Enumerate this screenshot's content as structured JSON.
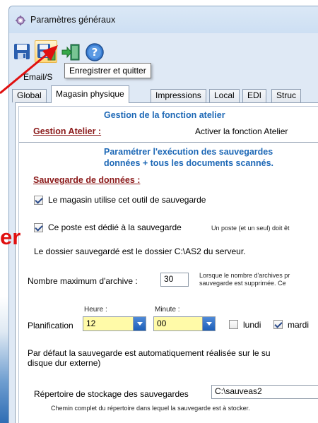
{
  "window": {
    "title": "Paramètres généraux"
  },
  "toolbar": {
    "buttons": [
      {
        "name": "save-icon"
      },
      {
        "name": "save-and-quit-icon"
      },
      {
        "name": "exit-icon"
      },
      {
        "name": "help-icon"
      }
    ],
    "tooltip": "Enregistrer et quitter",
    "hidden_label": "Email/S"
  },
  "tabs": [
    "Global",
    "Magasin physique",
    "Impressions",
    "Local",
    "EDI",
    "Struc"
  ],
  "active_tab": "Magasin physique",
  "atelier": {
    "header": "Gestion de la fonction atelier",
    "label": "Gestion Atelier :",
    "option": "Activer la fonction Atelier"
  },
  "backup": {
    "header_line1": "Paramétrer l'exécution des sauvegardes",
    "header_line2": "données + tous les documents scannés.",
    "label": "Sauvegarde de données :",
    "cb_store_uses_tool": "Le magasin utilise cet outil de sauvegarde",
    "cb_store_uses_tool_checked": true,
    "cb_post_dedicated": "Ce poste est dédié à la sauvegarde",
    "cb_post_dedicated_checked": true,
    "post_note": "Un poste (et un seul) doit êt",
    "folder_info": "Le dossier sauvegardé est le dossier C:\\AS2 du serveur.",
    "max_archive_label": "Nombre maximum d'archive :",
    "max_archive_value": "30",
    "max_archive_note1": "Lorsque le nombre d'archives pr",
    "max_archive_note2": "sauvegarde est supprimée. Ce",
    "heure_label": "Heure :",
    "minute_label": "Minute :",
    "planification_label": "Planification",
    "heure_value": "12",
    "minute_value": "00",
    "day1": "lundi",
    "day1_checked": false,
    "day2": "mardi",
    "day2_checked": true,
    "default_note1": "Par défaut la sauvegarde est automatiquement réalisée sur le su",
    "default_note2": "disque dur externe)",
    "storage_label": "Répertoire de stockage des sauvegardes",
    "storage_value": "C:\\sauveas2",
    "storage_hint": "Chemin complet du répertoire dans lequel la sauvegarde est à stocker."
  },
  "overlay": {
    "text": "er",
    "color": "#e01010"
  },
  "colors": {
    "section_blue": "#1d68b6",
    "section_red": "#8b1a1a",
    "combo_bg": "#fffaa8"
  }
}
